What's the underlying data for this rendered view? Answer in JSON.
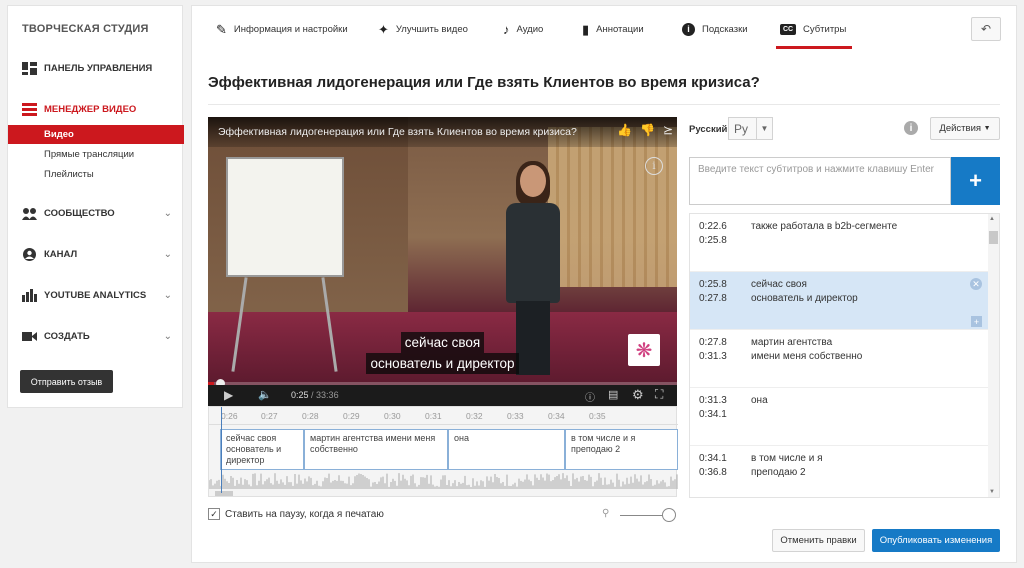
{
  "sidebar": {
    "title": "ТВОРЧЕСКАЯ СТУДИЯ",
    "items": [
      {
        "label": "ПАНЕЛЬ УПРАВЛЕНИЯ"
      },
      {
        "label": "МЕНЕДЖЕР ВИДЕО"
      },
      {
        "label": "СООБЩЕСТВО"
      },
      {
        "label": "КАНАЛ"
      },
      {
        "label": "YOUTUBE ANALYTICS"
      },
      {
        "label": "СОЗДАТЬ"
      }
    ],
    "subitems": [
      {
        "label": "Видео"
      },
      {
        "label": "Прямые трансляции"
      },
      {
        "label": "Плейлисты"
      }
    ],
    "feedback_label": "Отправить отзыв"
  },
  "tabs": [
    {
      "label": "Информация и настройки",
      "icon": "pencil-icon"
    },
    {
      "label": "Улучшить видео",
      "icon": "magic-wand-icon"
    },
    {
      "label": "Аудио",
      "icon": "music-note-icon"
    },
    {
      "label": "Аннотации",
      "icon": "speech-bubble-icon"
    },
    {
      "label": "Подсказки",
      "icon": "info-icon"
    },
    {
      "label": "Субтитры",
      "icon": "cc-icon"
    }
  ],
  "page_title": "Эффективная лидогенерация или Где взять Клиентов во время кризиса?",
  "player": {
    "video_title": "Эффективная лидогенерация или Где взять Клиентов во время кризиса?",
    "caption_line1": "сейчас своя",
    "caption_line2": "основатель и директор",
    "current_time": "0:25",
    "duration": "33:36",
    "progress_fraction": 0.012
  },
  "timeline": {
    "ticks": [
      "0:26",
      "0:27",
      "0:28",
      "0:29",
      "0:30",
      "0:31",
      "0:32",
      "0:33",
      "0:34",
      "0:35"
    ],
    "segments": [
      {
        "text": "сейчас своя основатель и директор"
      },
      {
        "text": "мартин агентства имени меня собственно"
      },
      {
        "text": "она"
      },
      {
        "text": "в том числе и я преподаю 2"
      }
    ]
  },
  "pause_label": "Ставить на паузу, когда я печатаю",
  "language": {
    "label": "Русский",
    "code": "Ру"
  },
  "actions_label": "Действия",
  "subtitle_input_placeholder": "Введите текст субтитров и нажмите клавишу Enter",
  "subtitles": [
    {
      "start": "0:22.6",
      "end": "0:25.8",
      "line1": "также работала в b2b-сегменте",
      "line2": ""
    },
    {
      "start": "0:25.8",
      "end": "0:27.8",
      "line1": "сейчас своя",
      "line2": "основатель и директор"
    },
    {
      "start": "0:27.8",
      "end": "0:31.3",
      "line1": "мартин агентства",
      "line2": "имени меня собственно"
    },
    {
      "start": "0:31.3",
      "end": "0:34.1",
      "line1": "она",
      "line2": ""
    },
    {
      "start": "0:34.1",
      "end": "0:36.8",
      "line1": "в том числе и я",
      "line2": "преподаю 2"
    }
  ],
  "buttons": {
    "revert": "Отменить правки",
    "publish": "Опубликовать изменения"
  },
  "colors": {
    "accent_red": "#cc181e",
    "primary_blue": "#167ac6",
    "selected_row": "#d6e6f6"
  }
}
